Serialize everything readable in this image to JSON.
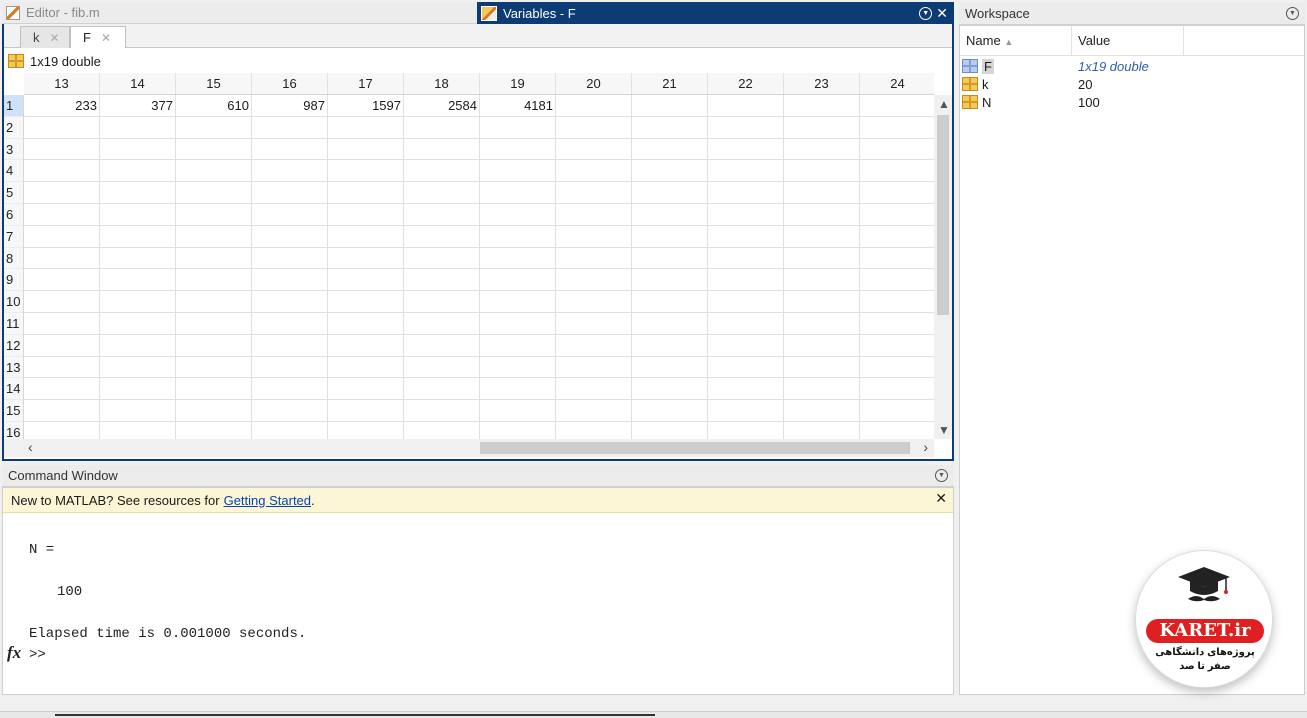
{
  "editor": {
    "title": "Editor - fib.m"
  },
  "variables": {
    "title": "Variables - F",
    "tabs": [
      {
        "label": "k",
        "close": "✕"
      },
      {
        "label": "F",
        "close": "✕"
      }
    ],
    "size_label": "1x19 double",
    "columns": [
      "13",
      "14",
      "15",
      "16",
      "17",
      "18",
      "19",
      "20",
      "21",
      "22",
      "23",
      "24"
    ],
    "rows": [
      "1",
      "2",
      "3",
      "4",
      "5",
      "6",
      "7",
      "8",
      "9",
      "10",
      "11",
      "12",
      "13",
      "14",
      "15",
      "16"
    ],
    "row1_values": [
      "233",
      "377",
      "610",
      "987",
      "1597",
      "2584",
      "4181",
      "",
      "",
      "",
      "",
      ""
    ]
  },
  "workspace": {
    "title": "Workspace",
    "col_name": "Name",
    "col_value": "Value",
    "items": [
      {
        "name": "F",
        "value": "1x19 double"
      },
      {
        "name": "k",
        "value": "20"
      },
      {
        "name": "N",
        "value": "100"
      }
    ]
  },
  "command": {
    "title": "Command Window",
    "banner_text": "New to MATLAB? See resources for",
    "banner_link": "Getting Started",
    "banner_period": ".",
    "line1": "N =",
    "line2": "100",
    "line3": "Elapsed time is 0.001000 seconds.",
    "prompt": ">>",
    "fx": "fx"
  },
  "logo": {
    "brand": "KARET.ir",
    "tagline1": "پروژه‌های دانشگاهی",
    "tagline2": "صفر تا صد"
  }
}
